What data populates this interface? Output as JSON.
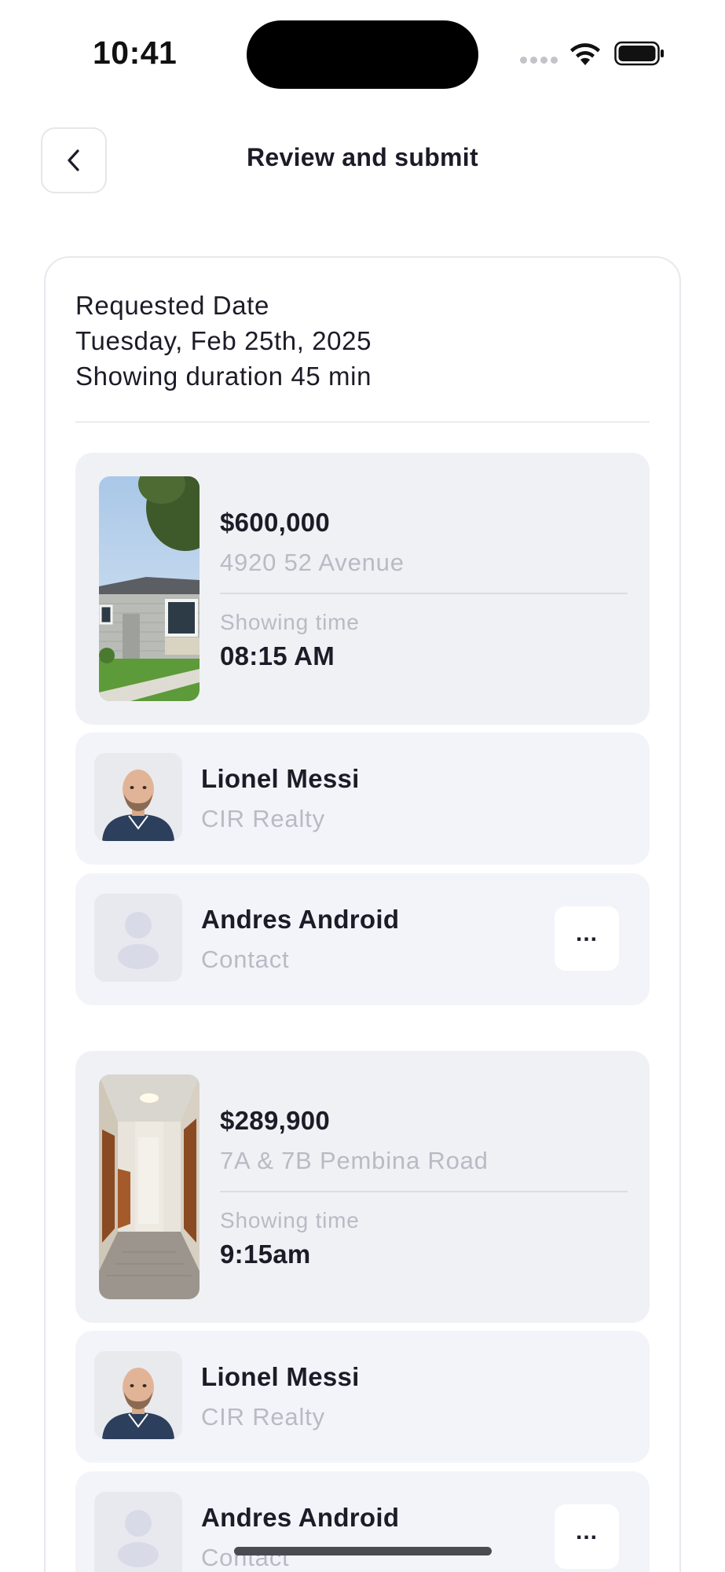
{
  "status_bar": {
    "time": "10:41"
  },
  "header": {
    "title": "Review and submit"
  },
  "request": {
    "label": "Requested Date",
    "date": "Tuesday, Feb 25th, 2025",
    "duration": "Showing duration 45 min"
  },
  "showings": [
    {
      "price": "$600,000",
      "address": "4920 52 Avenue",
      "showing_time_label": "Showing time",
      "showing_time": "08:15 AM",
      "agent": {
        "name": "Lionel Messi",
        "company": "CIR Realty"
      },
      "contact": {
        "name": "Andres Android",
        "role": "Contact",
        "more_label": "..."
      }
    },
    {
      "price": "$289,900",
      "address": "7A & 7B Pembina Road",
      "showing_time_label": "Showing time",
      "showing_time": "9:15am",
      "agent": {
        "name": "Lionel Messi",
        "company": "CIR Realty"
      },
      "contact": {
        "name": "Andres Android",
        "role": "Contact",
        "more_label": "..."
      }
    }
  ],
  "colors": {
    "card_bg": "#f0f1f5",
    "muted_text": "#b9bac4",
    "primary_text": "#1c1c28"
  },
  "icons": {
    "back": "chevron-left-icon",
    "wifi": "wifi-icon",
    "battery": "battery-icon",
    "contact_placeholder": "user-placeholder-icon"
  }
}
